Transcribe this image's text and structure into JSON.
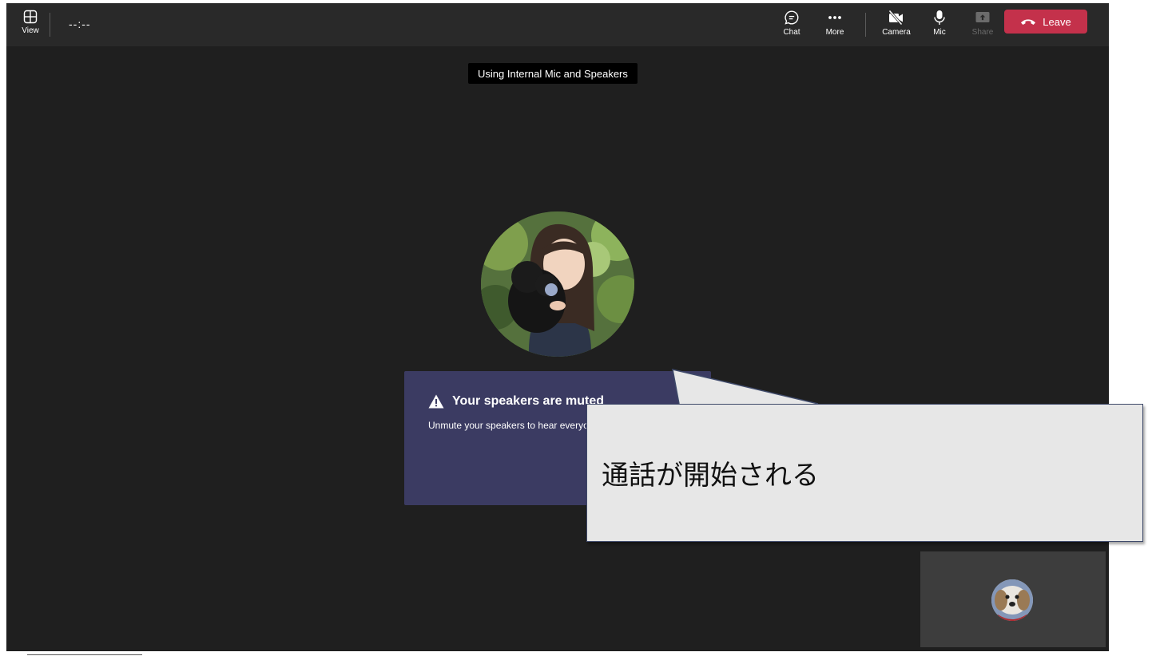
{
  "toolbar": {
    "view_label": "View",
    "timer": "--:--",
    "chat_label": "Chat",
    "more_label": "More",
    "camera_label": "Camera",
    "mic_label": "Mic",
    "share_label": "Share",
    "leave_label": "Leave"
  },
  "device_toast": "Using Internal Mic and Speakers",
  "muted_panel": {
    "title": "Your speakers are muted",
    "body": "Unmute your speakers to hear everyone"
  },
  "callout": {
    "text": "通話が開始される"
  },
  "colors": {
    "leave": "#c4314b",
    "panel": "#3b3b62",
    "stage": "#1f1f1f",
    "toolbar": "#292929"
  }
}
